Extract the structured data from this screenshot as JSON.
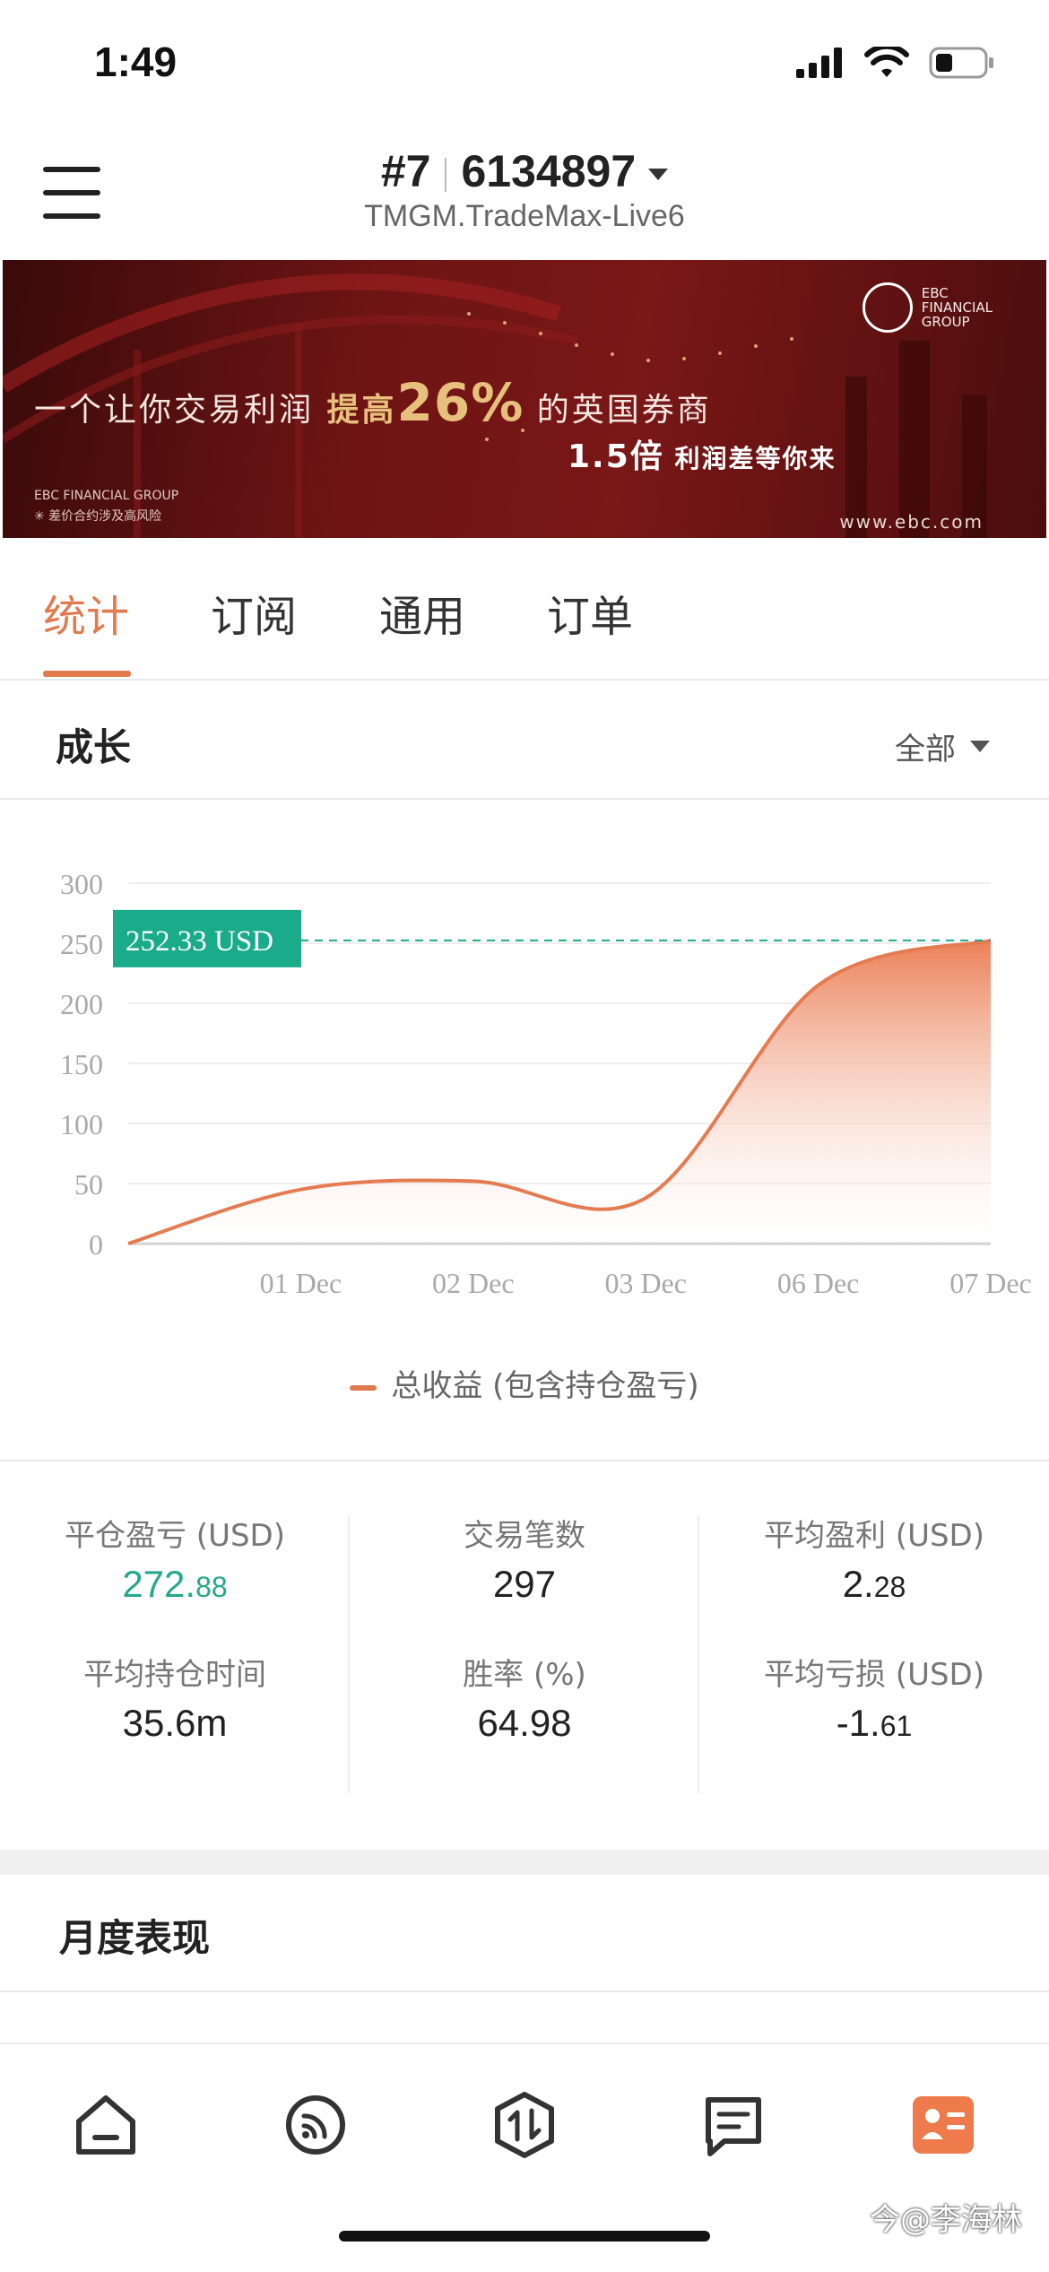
{
  "status_bar": {
    "time": "1:49"
  },
  "header": {
    "account_rank": "#7",
    "account_number": "6134897",
    "server": "TMGM.TradeMax-Live6"
  },
  "banner": {
    "main_prefix": "一个让你交易利润",
    "main_highlight": "提高",
    "main_percent": "26%",
    "main_suffix": "的英国券商",
    "sub_multiplier": "1.5倍",
    "sub_text": "利润差等你来",
    "footer_brand": "EBC FINANCIAL GROUP",
    "footer_risk": "✳ 差价合约涉及高风险",
    "url": "www.ebc.com",
    "logo_line1": "EBC",
    "logo_line2": "FINANCIAL",
    "logo_line3": "GROUP"
  },
  "tabs": [
    {
      "label": "统计",
      "active": true
    },
    {
      "label": "订阅",
      "active": false
    },
    {
      "label": "通用",
      "active": false
    },
    {
      "label": "订单",
      "active": false
    }
  ],
  "growth": {
    "title": "成长",
    "filter_label": "全部"
  },
  "chart_data": {
    "type": "area",
    "title": "",
    "xlabel": "",
    "ylabel": "",
    "ylim": [
      0,
      300
    ],
    "yticks": [
      "0",
      "50",
      "100",
      "150",
      "200",
      "250",
      "300"
    ],
    "xticks": [
      "01 Dec",
      "02 Dec",
      "03 Dec",
      "06 Dec",
      "07 Dec"
    ],
    "grid": true,
    "series": [
      {
        "name": "总收益 (包含持仓盈亏)",
        "color": "#e07b4f",
        "x": [
          "start",
          "01 Dec",
          "02 Dec",
          "03 Dec",
          "06 Dec",
          "07 Dec"
        ],
        "values": [
          0,
          45,
          52,
          38,
          215,
          252.33
        ]
      }
    ],
    "callout_label": "252.33 USD",
    "callout_color": "#1aab8b"
  },
  "stats": {
    "closed_pnl": {
      "label": "平仓盈亏 (USD)",
      "int": "272.",
      "frac": "88"
    },
    "trades": {
      "label": "交易笔数",
      "value": "297"
    },
    "avg_profit": {
      "label": "平均盈利 (USD)",
      "int": "2.",
      "frac": "28"
    },
    "avg_hold": {
      "label": "平均持仓时间",
      "value": "35.6m"
    },
    "win_rate": {
      "label": "胜率 (%)",
      "value": "64.98"
    },
    "avg_loss": {
      "label": "平均亏损 (USD)",
      "int": "-1.",
      "frac": "61"
    }
  },
  "monthly": {
    "title": "月度表现"
  },
  "bottom_nav": [
    {
      "icon": "home-icon"
    },
    {
      "icon": "signal-icon"
    },
    {
      "icon": "trade-icon"
    },
    {
      "icon": "news-icon"
    },
    {
      "icon": "profile-card-icon",
      "active": true
    }
  ],
  "watermark": "今@李海林"
}
